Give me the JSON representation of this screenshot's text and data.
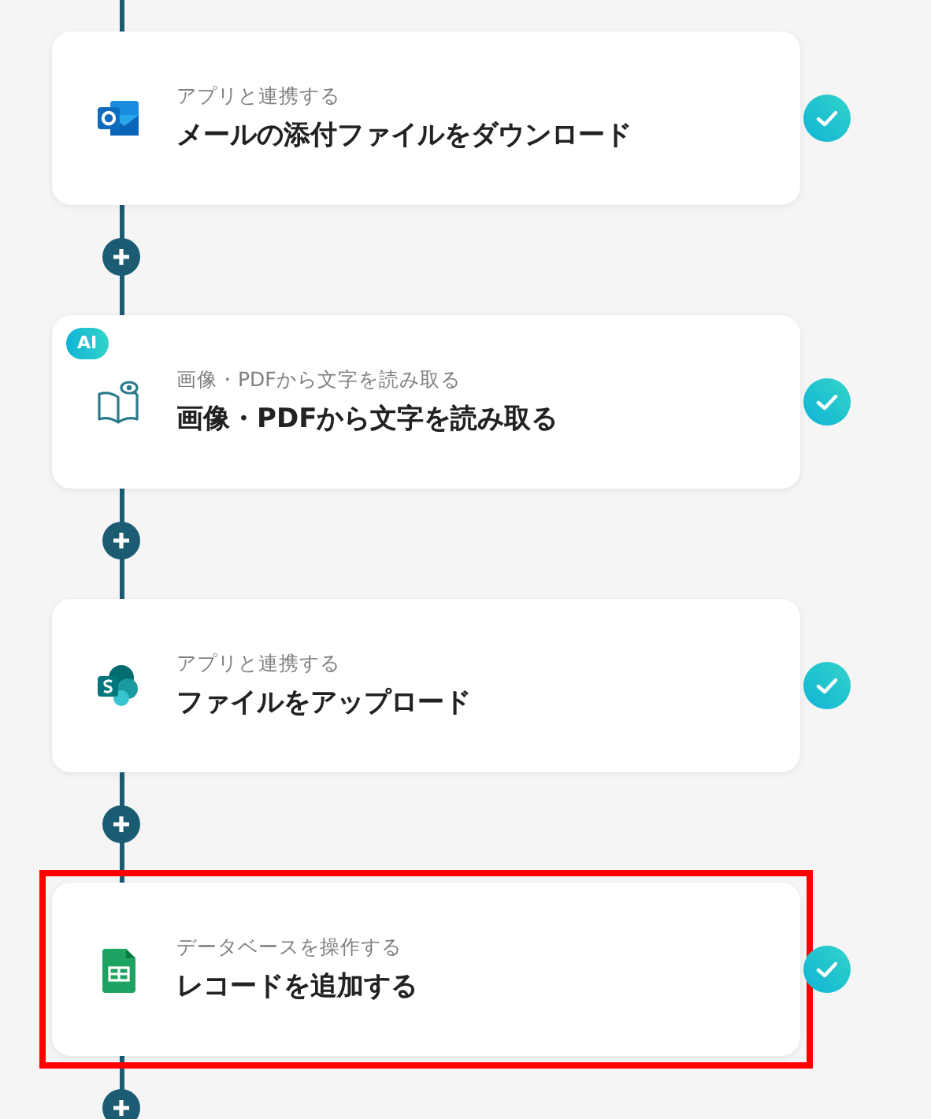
{
  "steps": [
    {
      "caption": "アプリと連携する",
      "title": "メールの添付ファイルをダウンロード",
      "highlighted": false,
      "completed": true
    },
    {
      "badge": "AI",
      "caption": "画像・PDFから文字を読み取る",
      "title": "画像・PDFから文字を読み取る",
      "highlighted": false,
      "completed": true
    },
    {
      "caption": "アプリと連携する",
      "title": "ファイルをアップロード",
      "highlighted": false,
      "completed": true
    },
    {
      "caption": "データベースを操作する",
      "title": "レコードを追加する",
      "highlighted": true,
      "completed": true
    }
  ]
}
